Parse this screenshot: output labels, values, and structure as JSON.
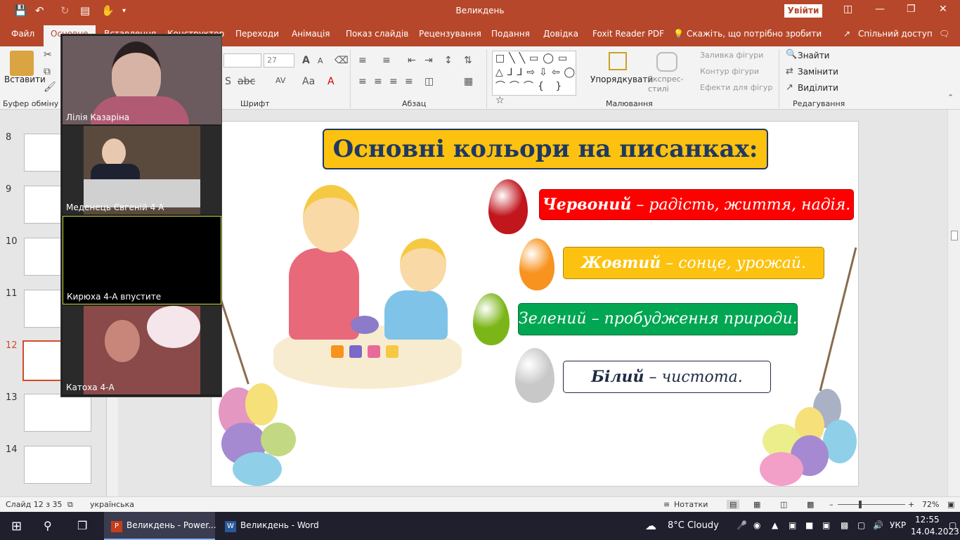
{
  "window": {
    "title": "Великдень",
    "signin_label": "Увійти"
  },
  "tabs": [
    "Файл",
    "Основне",
    "Вставлення",
    "Конструктор",
    "Переходи",
    "Анімація",
    "Показ слайдів",
    "Рецензування",
    "Подання",
    "Довідка",
    "Foxit Reader PDF",
    "Скажіть, що потрібно зробити",
    "Спільний доступ"
  ],
  "ribbon": {
    "paste_label": "Вставити",
    "clipboard_label": "Буфер обміну",
    "font_label": "Шрифт",
    "font_size_value": "27",
    "paragraph_label": "Абзац",
    "drawing_label": "Малювання",
    "arrange_label": "Упорядкувати",
    "quick_styles_label": "Експрес-стилі",
    "shape_fill_label": "Заливка фігури",
    "shape_outline_label": "Контур фігури",
    "shape_effects_label": "Ефекти для фігур",
    "find_label": "Знайти",
    "replace_label": "Замінити",
    "select_label": "Виділити",
    "editing_label": "Редагування"
  },
  "thumbnails": [
    {
      "num": "8"
    },
    {
      "num": "9"
    },
    {
      "num": "10"
    },
    {
      "num": "11"
    },
    {
      "num": "12"
    },
    {
      "num": "13"
    },
    {
      "num": "14"
    }
  ],
  "slide": {
    "title": "Основні кольори на писанках:",
    "colors": [
      {
        "name": "Червоний",
        "meaning": " – радість, життя, надія.",
        "box": "#ff0000",
        "text": "#ffffff",
        "egg": "#c0161c"
      },
      {
        "name": "Жовтий",
        "meaning": " – сонце, урожай.",
        "box": "#fcc20f",
        "text": "#ffffff",
        "egg": "#f7931e"
      },
      {
        "name": "Зелений",
        "meaning": " – пробудження природи.",
        "box": "#00a651",
        "text": "#ffffff",
        "egg": "#7cb518"
      },
      {
        "name": "Білий",
        "meaning": " – чистота.",
        "box": "#ffffff",
        "text": "#1f2a44",
        "egg": "#c8c8c8"
      }
    ]
  },
  "participants": [
    {
      "name": "Лілія Казаріна"
    },
    {
      "name": "Меденець Євгеній 4 А"
    },
    {
      "name": "Кирюха 4-А впустите"
    },
    {
      "name": "Катоха 4-А"
    }
  ],
  "statusbar": {
    "slide_info": "Слайд 12 з 35",
    "language": "українська",
    "notes_label": "Нотатки",
    "zoom": "72%"
  },
  "taskbar": {
    "app1": "Великдень - Power...",
    "app2": "Великдень - Word",
    "weather": "8°C  Cloudy",
    "lang": "УКР",
    "time": "12:55",
    "date": "14.04.2023"
  }
}
